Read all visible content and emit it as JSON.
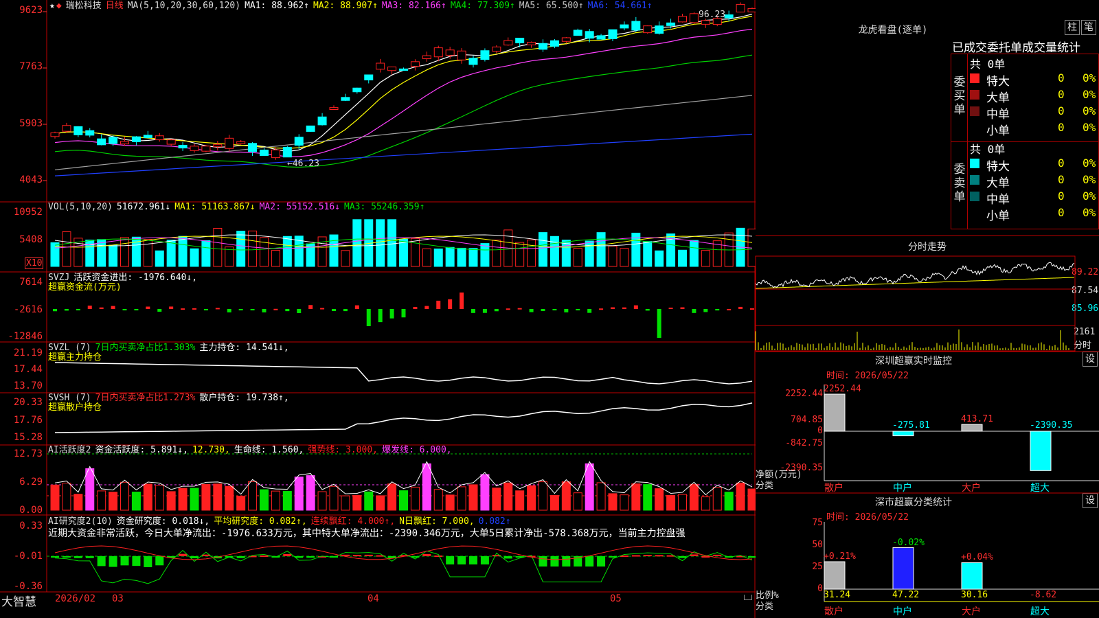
{
  "theme": {
    "up": "#ff2020",
    "down": "#00ffff",
    "axis": "#ff3030",
    "grid": "#9a0000",
    "white": "#ffffff",
    "yellow": "#ffff00",
    "magenta": "#ff40ff",
    "green": "#00d000",
    "gray": "#a0a0a0",
    "blue": "#2040ff"
  },
  "stock": {
    "name": "瑞松科技",
    "period": "日线",
    "ma_params": "MA(5,10,20,30,60,120)"
  },
  "main_chart": {
    "ma": [
      {
        "label": "MA1: 88.962↑",
        "color": "#ffffff"
      },
      {
        "label": "MA2: 88.907↑",
        "color": "#ffff00"
      },
      {
        "label": "MA3: 82.166↑",
        "color": "#ff40ff"
      },
      {
        "label": "MA4: 77.309↑",
        "color": "#00e000"
      },
      {
        "label": "MA5: 65.500↑",
        "color": "#c0c0c0"
      },
      {
        "label": "MA6: 54.661↑",
        "color": "#2040ff"
      }
    ],
    "y_ticks": [
      "9623",
      "7763",
      "5903",
      "4043"
    ],
    "high_label": "96.23",
    "low_label": "46.23"
  },
  "vol": {
    "header": "VOL(5,10,20)",
    "value": "51672.961↓",
    "ma1": "MA1: 51163.867↓",
    "ma2": "MA2: 55152.516↓",
    "ma3": "MA3: 55246.359↑",
    "y_ticks": [
      "10952",
      "5408"
    ],
    "unit": "X10"
  },
  "svzj": {
    "header": "SVZJ",
    "value": "活跃资金进出: -1976.640↓,",
    "sub": "超赢资金流(万元)",
    "y_ticks": [
      "7614",
      "-2616",
      "-12846"
    ]
  },
  "svzl": {
    "header": "SVZL (7)",
    "ratio": "7日内买卖净占比1.303%",
    "value": "主力持仓: 14.541↓,",
    "sub": "超赢主力持仓",
    "y_ticks": [
      "21.19",
      "17.44",
      "13.70"
    ]
  },
  "svsh": {
    "header": "SVSH (7)",
    "ratio": "7日内买卖净占比1.273%",
    "value": "散户持仓: 19.738↑,",
    "sub": "超赢散户持仓",
    "y_ticks": [
      "20.33",
      "17.76",
      "15.28"
    ]
  },
  "ai1": {
    "header": "AI活跃度2",
    "v1": "资金活跃度: 5.891↓,",
    "v2": "12.730,",
    "v3": "生命线: 1.560,",
    "v4": "强势线: 3.000,",
    "v5": "爆发线: 6.000,",
    "y_ticks": [
      "12.73",
      "6.29",
      "0.00"
    ]
  },
  "ai2": {
    "header": "AI研究度2(10)",
    "v1": "资金研究度: 0.018↓,",
    "v2": "平均研究度: 0.082↑,",
    "v3": "连续飘红: 4.000↑,",
    "v4": "N日飘红: 7.000,",
    "v5": "0.082↑",
    "summary": "近期大资金非常活跃，今日大单净流出：-1976.633万元，其中特大单净流出：-2390.346万元，大单5日累计净出-578.368万元，当前主力控盘强",
    "y_ticks": [
      "0.33",
      "-0.01",
      "-0.36"
    ]
  },
  "x_axis": {
    "brand": "大智慧",
    "labels": [
      "2026/02",
      "03",
      "04",
      "05"
    ]
  },
  "dragon": {
    "title": "龙虎看盘(逐单)",
    "btn1": "柱",
    "btn2": "笔",
    "tab_header": "已成交委托单成交量统计",
    "buy": {
      "side_label": "委买单",
      "total": "共 0单",
      "rows": [
        {
          "name": "特大",
          "count": "0",
          "pct": "0%",
          "color": "#ff2020"
        },
        {
          "name": "大单",
          "count": "0",
          "pct": "0%",
          "color": "#a01010"
        },
        {
          "name": "中单",
          "count": "0",
          "pct": "0%",
          "color": "#701010"
        },
        {
          "name": "小单",
          "count": "0",
          "pct": "0%",
          "color": "#000000"
        }
      ]
    },
    "sell": {
      "side_label": "委卖单",
      "total": "共 0单",
      "rows": [
        {
          "name": "特大",
          "count": "0",
          "pct": "0%",
          "color": "#00ffff"
        },
        {
          "name": "大单",
          "count": "0",
          "pct": "0%",
          "color": "#008080"
        },
        {
          "name": "中单",
          "count": "0",
          "pct": "0%",
          "color": "#006060"
        },
        {
          "name": "小单",
          "count": "0",
          "pct": "0%",
          "color": "#000000"
        }
      ]
    }
  },
  "intraday": {
    "title": "分时走势",
    "y_ticks": [
      "89.22",
      "87.54",
      "85.96"
    ],
    "vol_tick": "2161",
    "vol_unit": "分时"
  },
  "sz_monitor": {
    "title": "深圳超赢实时监控",
    "btn": "设",
    "time": "时间: 2026/05/22",
    "y_ticks": [
      "2252.44",
      "704.85",
      "0",
      "-842.75",
      "-2390.35"
    ],
    "ylabel": "净额(万元)",
    "xlabel": "分类",
    "bars": [
      {
        "name": "散户",
        "value": 2252.44,
        "label": "2252.44"
      },
      {
        "name": "中户",
        "value": -275.81,
        "label": "-275.81"
      },
      {
        "name": "大户",
        "value": 413.71,
        "label": "413.71"
      },
      {
        "name": "超大",
        "value": -2390.35,
        "label": "-2390.35"
      }
    ]
  },
  "sz_class": {
    "title": "深市超赢分类统计",
    "btn": "设",
    "time": "时间: 2026/05/22",
    "y_ticks": [
      "75",
      "50",
      "25",
      "0"
    ],
    "ylabel": "比例%",
    "xlabel": "分类",
    "bars": [
      {
        "name": "散户",
        "value": 31.24,
        "change": "+0.21%"
      },
      {
        "name": "中户",
        "value": 47.22,
        "change": "-0.02%"
      },
      {
        "name": "大户",
        "value": 30.16,
        "change": "+0.04%"
      },
      {
        "name": "超大",
        "value": -8.62,
        "change": ""
      }
    ]
  },
  "chart_data": [
    {
      "type": "line",
      "title": "",
      "series": [
        {
          "name": "MA1",
          "values": [
            54,
            57,
            60,
            58,
            52,
            50,
            51,
            56,
            70,
            80,
            84,
            86,
            83,
            90,
            95,
            93,
            89
          ]
        }
      ]
    },
    {
      "type": "bar",
      "categories": [
        "散户",
        "中户",
        "大户",
        "超大"
      ],
      "values": [
        2252.44,
        -275.81,
        413.71,
        -2390.35
      ],
      "ylabel": "净额(万元)",
      "xlabel": "分类"
    },
    {
      "type": "bar",
      "categories": [
        "散户",
        "中户",
        "大户",
        "超大"
      ],
      "values": [
        31.24,
        47.22,
        30.16,
        -8.62
      ],
      "ylabel": "比例%",
      "xlabel": "分类",
      "ylim": [
        0,
        75
      ]
    }
  ]
}
